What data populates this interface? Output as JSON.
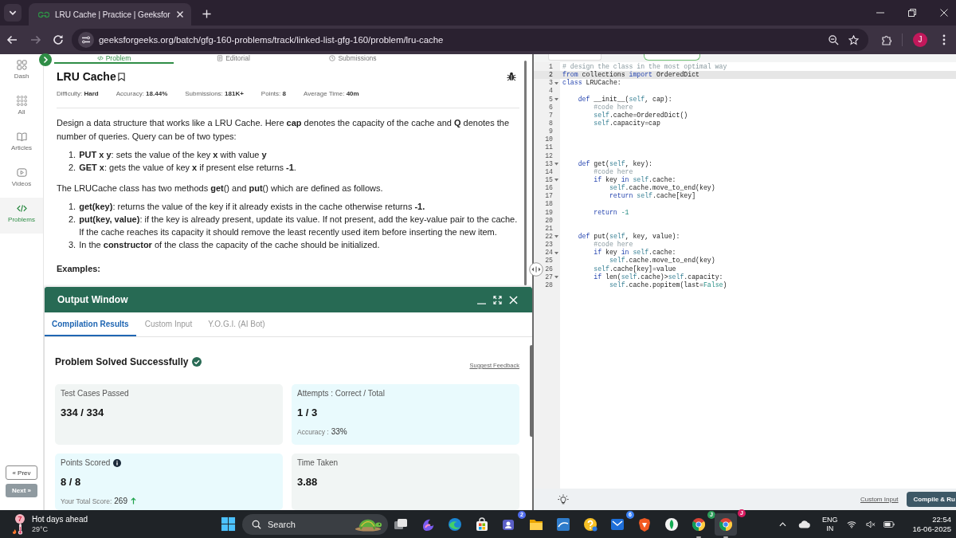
{
  "browser": {
    "tab": {
      "title": "LRU Cache | Practice | Geeksfor"
    },
    "back_disabled": false,
    "forward_disabled": true,
    "url": "geeksforgeeks.org/batch/gfg-160-problems/track/linked-list-gfg-160/problem/lru-cache",
    "profile_initial": "J"
  },
  "sidebar": {
    "items": [
      {
        "kind": "dashboard",
        "label": "Dash",
        "selected": false
      },
      {
        "kind": "grid",
        "label": "All",
        "selected": false
      },
      {
        "kind": "book",
        "label": "Articles",
        "selected": false
      },
      {
        "kind": "play",
        "label": "Videos",
        "selected": false
      },
      {
        "kind": "code",
        "label": "Problems",
        "selected": true
      }
    ],
    "prev_button": "« Prev",
    "next_button": "Next »"
  },
  "problem_tabs": [
    {
      "kind": "code",
      "label": "Problem",
      "selected": true
    },
    {
      "kind": "document",
      "label": "Editorial",
      "selected": false
    },
    {
      "kind": "clock",
      "label": "Submissions",
      "selected": false
    }
  ],
  "problem": {
    "title": "LRU Cache",
    "meta": [
      "Difficulty: **Hard**",
      "Accuracy: **18.44%**",
      "Submissions: **181K+**",
      "Points: **8**",
      "Average Time: **40m**"
    ],
    "blocks": [
      {
        "kind": "paragraph",
        "text": "Design a data structure that works like a LRU Cache. Here **cap** denotes the capacity of the cache and **Q** denotes the number of queries. Query can be of two types:"
      },
      {
        "kind": "list",
        "items": [
          {
            "number": "1.",
            "text": "**PUT x y**: sets the value of the key **x** with value **y**"
          },
          {
            "number": "2.",
            "text": "**GET x**: gets the value of key **x** if present else returns **-1**."
          }
        ]
      },
      {
        "kind": "paragraph",
        "text": "The LRUCache class has two methods **get**() and **put**() which are defined as follows."
      },
      {
        "kind": "list",
        "items": [
          {
            "number": "1.",
            "text": "**get(key)**: returns the value of the key if it already exists in the cache otherwise returns **-1.**"
          },
          {
            "number": "2.",
            "text": "**put(key, value)**: if the key is already present, update its value. If not present, add the key-value pair to the cache. If the cache reaches its capacity it should remove the least recently used item before inserting the new item."
          },
          {
            "number": "3.",
            "text": "In the **constructor** of the class the capacity of the cache should be initialized."
          }
        ]
      },
      {
        "kind": "heading",
        "text": "Examples:"
      }
    ]
  },
  "output_window": {
    "title": "Output Window",
    "tabs": [
      {
        "label": "Compilation Results",
        "selected": true
      },
      {
        "label": "Custom Input",
        "selected": false
      },
      {
        "label": "Y.O.G.I. (AI Bot)",
        "selected": false
      }
    ],
    "status": "Problem Solved Successfully",
    "feedback_link": "Suggest Feedback",
    "cards": [
      {
        "label": "Test Cases Passed",
        "info": false,
        "value": "334 / 334",
        "trend_up": false,
        "color": "#f1f5f4"
      },
      {
        "label": "Attempts : Correct / Total",
        "info": false,
        "value": "1 / 3",
        "note_label": "Accuracy :",
        "note_value": "33%",
        "trend_up": false,
        "color": "#e9fafd"
      },
      {
        "label": "Points Scored",
        "info": true,
        "value": "8 / 8",
        "note_label": "Your Total Score:",
        "note_value": "269",
        "trend_up": true,
        "color": "#e9fafd"
      },
      {
        "label": "Time Taken",
        "info": false,
        "value": "3.88",
        "trend_up": false,
        "color": "#f1f5f4"
      }
    ]
  },
  "editor": {
    "lines": [
      {
        "n": "1",
        "active": false,
        "foldable": false,
        "code": [
          {
            "kind": "comment",
            "text": "# design the class in the most optimal way"
          }
        ]
      },
      {
        "n": "2",
        "active": true,
        "foldable": false,
        "code": [
          {
            "kind": "keyword",
            "text": "from"
          },
          {
            "kind": "plain",
            "text": " collections "
          },
          {
            "kind": "keyword",
            "text": "import"
          },
          {
            "kind": "plain",
            "text": " OrderedDict"
          }
        ]
      },
      {
        "n": "3",
        "active": false,
        "foldable": true,
        "code": [
          {
            "kind": "keyword",
            "text": "class"
          },
          {
            "kind": "plain",
            "text": " LRUCache:"
          }
        ]
      },
      {
        "n": "4",
        "active": false,
        "foldable": false
      },
      {
        "n": "5",
        "active": false,
        "foldable": true,
        "code": [
          {
            "kind": "keyword",
            "text": "    def"
          },
          {
            "kind": "plain",
            "text": " __init__("
          },
          {
            "kind": "self",
            "text": "self"
          },
          {
            "kind": "plain",
            "text": ", cap):"
          }
        ]
      },
      {
        "n": "6",
        "active": false,
        "foldable": false,
        "code": [
          {
            "kind": "comment",
            "text": "        #code here"
          }
        ]
      },
      {
        "n": "7",
        "active": false,
        "foldable": false,
        "code": [
          {
            "kind": "self",
            "text": "        self"
          },
          {
            "kind": "plain",
            "text": ".cache=OrderedDict()"
          }
        ]
      },
      {
        "n": "8",
        "active": false,
        "foldable": false,
        "code": [
          {
            "kind": "self",
            "text": "        self"
          },
          {
            "kind": "plain",
            "text": ".capacity=cap"
          }
        ]
      },
      {
        "n": "9",
        "active": false,
        "foldable": false
      },
      {
        "n": "10",
        "active": false,
        "foldable": false
      },
      {
        "n": "11",
        "active": false,
        "foldable": false
      },
      {
        "n": "12",
        "active": false,
        "foldable": false
      },
      {
        "n": "13",
        "active": false,
        "foldable": true,
        "code": [
          {
            "kind": "keyword",
            "text": "    def"
          },
          {
            "kind": "plain",
            "text": " get("
          },
          {
            "kind": "self",
            "text": "self"
          },
          {
            "kind": "plain",
            "text": ", key):"
          }
        ]
      },
      {
        "n": "14",
        "active": false,
        "foldable": false,
        "code": [
          {
            "kind": "comment",
            "text": "        #code here"
          }
        ]
      },
      {
        "n": "15",
        "active": false,
        "foldable": true,
        "code": [
          {
            "kind": "keyword",
            "text": "        if"
          },
          {
            "kind": "plain",
            "text": " key "
          },
          {
            "kind": "keyword",
            "text": "in"
          },
          {
            "kind": "self",
            "text": " self"
          },
          {
            "kind": "plain",
            "text": ".cache:"
          }
        ]
      },
      {
        "n": "16",
        "active": false,
        "foldable": false,
        "code": [
          {
            "kind": "self",
            "text": "            self"
          },
          {
            "kind": "plain",
            "text": ".cache.move_to_end(key)"
          }
        ]
      },
      {
        "n": "17",
        "active": false,
        "foldable": false,
        "code": [
          {
            "kind": "keyword",
            "text": "            return"
          },
          {
            "kind": "self",
            "text": " self"
          },
          {
            "kind": "plain",
            "text": ".cache[key]"
          }
        ]
      },
      {
        "n": "18",
        "active": false,
        "foldable": false
      },
      {
        "n": "19",
        "active": false,
        "foldable": false,
        "code": [
          {
            "kind": "keyword",
            "text": "        return"
          },
          {
            "kind": "number",
            "text": " -1"
          }
        ]
      },
      {
        "n": "20",
        "active": false,
        "foldable": false
      },
      {
        "n": "21",
        "active": false,
        "foldable": false
      },
      {
        "n": "22",
        "active": false,
        "foldable": true,
        "code": [
          {
            "kind": "keyword",
            "text": "    def"
          },
          {
            "kind": "plain",
            "text": " put("
          },
          {
            "kind": "self",
            "text": "self"
          },
          {
            "kind": "plain",
            "text": ", key, value):"
          }
        ]
      },
      {
        "n": "23",
        "active": false,
        "foldable": false,
        "code": [
          {
            "kind": "comment",
            "text": "        #code here"
          }
        ]
      },
      {
        "n": "24",
        "active": false,
        "foldable": true,
        "code": [
          {
            "kind": "keyword",
            "text": "        if"
          },
          {
            "kind": "plain",
            "text": " key "
          },
          {
            "kind": "keyword",
            "text": "in"
          },
          {
            "kind": "self",
            "text": " self"
          },
          {
            "kind": "plain",
            "text": ".cache:"
          }
        ]
      },
      {
        "n": "25",
        "active": false,
        "foldable": false,
        "code": [
          {
            "kind": "self",
            "text": "            self"
          },
          {
            "kind": "plain",
            "text": ".cache.move_to_end(key)"
          }
        ]
      },
      {
        "n": "26",
        "active": false,
        "foldable": false,
        "code": [
          {
            "kind": "self",
            "text": "        self"
          },
          {
            "kind": "plain",
            "text": ".cache[key]=value"
          }
        ]
      },
      {
        "n": "27",
        "active": false,
        "foldable": true,
        "code": [
          {
            "kind": "keyword",
            "text": "        if"
          },
          {
            "kind": "plain",
            "text": " len("
          },
          {
            "kind": "self",
            "text": "self"
          },
          {
            "kind": "plain",
            "text": ".cache)>"
          },
          {
            "kind": "self",
            "text": "self"
          },
          {
            "kind": "plain",
            "text": ".capacity:"
          }
        ]
      },
      {
        "n": "28",
        "active": false,
        "foldable": false,
        "code": [
          {
            "kind": "self",
            "text": "            self"
          },
          {
            "kind": "plain",
            "text": ".cache.popitem(last="
          },
          {
            "kind": "constant",
            "text": "False"
          },
          {
            "kind": "plain",
            "text": ")"
          }
        ]
      }
    ],
    "custom_input_link": "Custom Input",
    "run_button": "Compile & Ru"
  },
  "taskbar": {
    "weather": {
      "badge": "7",
      "headline": "Hot days ahead",
      "temperature": "29°C"
    },
    "search": {
      "label": "Search"
    },
    "apps": [
      {
        "kind": "stacked-windows",
        "running": false,
        "selected": false
      },
      {
        "kind": "swirl",
        "running": false,
        "selected": false
      },
      {
        "kind": "wave-circle",
        "running": false,
        "selected": false
      },
      {
        "kind": "bag",
        "running": false,
        "selected": false
      },
      {
        "kind": "people-tile",
        "badge": {
          "text": "2",
          "color": "#4f6bed"
        },
        "running": false,
        "selected": false
      },
      {
        "kind": "folder",
        "running": false,
        "selected": false
      },
      {
        "kind": "wave-tile",
        "running": false,
        "selected": false
      },
      {
        "kind": "question-circle",
        "running": false,
        "selected": false
      },
      {
        "kind": "envelope-tile",
        "badge": {
          "text": "6",
          "color": "#3b82f6"
        },
        "running": false,
        "selected": false
      },
      {
        "kind": "shield",
        "running": false,
        "selected": false
      },
      {
        "kind": "leaf-circle",
        "running": false,
        "selected": false
      },
      {
        "kind": "segmented-circle",
        "badge": {
          "text": "J",
          "color": "#2e9e5b"
        },
        "running": true,
        "selected": false
      },
      {
        "kind": "segmented-circle",
        "badge": {
          "text": "J",
          "color": "#d81b60"
        },
        "running": true,
        "selected": true
      }
    ],
    "tray": {
      "language": "ENG",
      "region": "IN",
      "time": "22:54",
      "date": "16-06-2025"
    }
  }
}
